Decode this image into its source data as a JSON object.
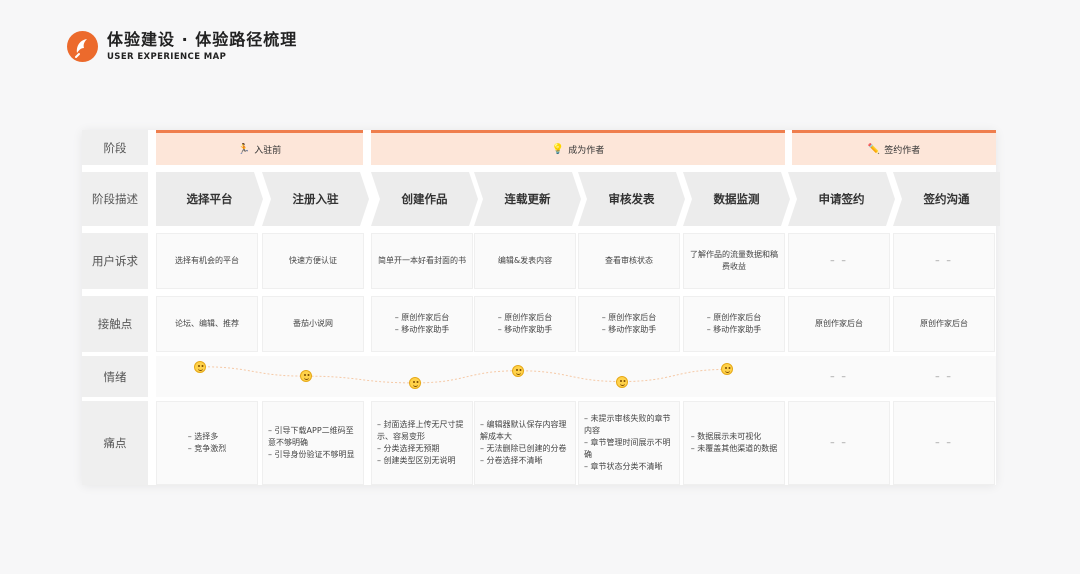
{
  "header": {
    "title": "体验建设 · 体验路径梳理",
    "subtitle": "USER EXPERIENCE MAP"
  },
  "colors": {
    "accent": "#ec6a2c",
    "phase_bg": "#fde6d9",
    "phase_border": "#ef7e4d",
    "face": "#ffd24a"
  },
  "row_labels": {
    "phase": "阶段",
    "stage": "阶段描述",
    "needs": "用户诉求",
    "touchpoints": "接触点",
    "emotion": "情绪",
    "pain": "痛点"
  },
  "phases": [
    {
      "label": "入驻前",
      "icon": "runner-icon"
    },
    {
      "label": "成为作者",
      "icon": "lightbulb-icon"
    },
    {
      "label": "签约作者",
      "icon": "pencil-icon"
    }
  ],
  "stages": [
    "选择平台",
    "注册入驻",
    "创建作品",
    "连载更新",
    "审核发表",
    "数据监测",
    "申请签约",
    "签约沟通"
  ],
  "needs": [
    "选择有机会的平台",
    "快速方便认证",
    "简单开一本好看封面的书",
    "编辑&发表内容",
    "查看审核状态",
    "了解作品的流量数据和稿费收益",
    "– –",
    "– –"
  ],
  "touchpoints": [
    [
      "论坛、编辑、推荐"
    ],
    [
      "番茄小说网"
    ],
    [
      "– 原创作家后台",
      "– 移动作家助手"
    ],
    [
      "– 原创作家后台",
      "– 移动作家助手"
    ],
    [
      "– 原创作家后台",
      "– 移动作家助手"
    ],
    [
      "– 原创作家后台",
      "– 移动作家助手"
    ],
    [
      "原创作家后台"
    ],
    [
      "原创作家后台"
    ]
  ],
  "emotion": {
    "levels": [
      0.9,
      0.55,
      0.3,
      0.75,
      0.35,
      0.8
    ],
    "empty": [
      "– –",
      "– –"
    ]
  },
  "pains": [
    [
      "– 选择多",
      "– 竞争激烈"
    ],
    [
      "– 引导下载APP二维码至意不够明确",
      "– 引导身份验证不够明显"
    ],
    [
      "– 封面选择上传无尺寸提示、容易变形",
      "– 分类选择无预期",
      "– 创建类型区别无说明"
    ],
    [
      "– 编辑器默认保存内容理解成本大",
      "– 无法删除已创建的分卷",
      "– 分卷选择不清晰"
    ],
    [
      "– 未提示审核失败的章节内容",
      "– 章节管理时间展示不明确",
      "– 章节状态分类不清晰"
    ],
    [
      "– 数据展示未可视化",
      "– 未覆盖其他渠道的数据"
    ],
    [
      "– –"
    ],
    [
      "– –"
    ]
  ]
}
